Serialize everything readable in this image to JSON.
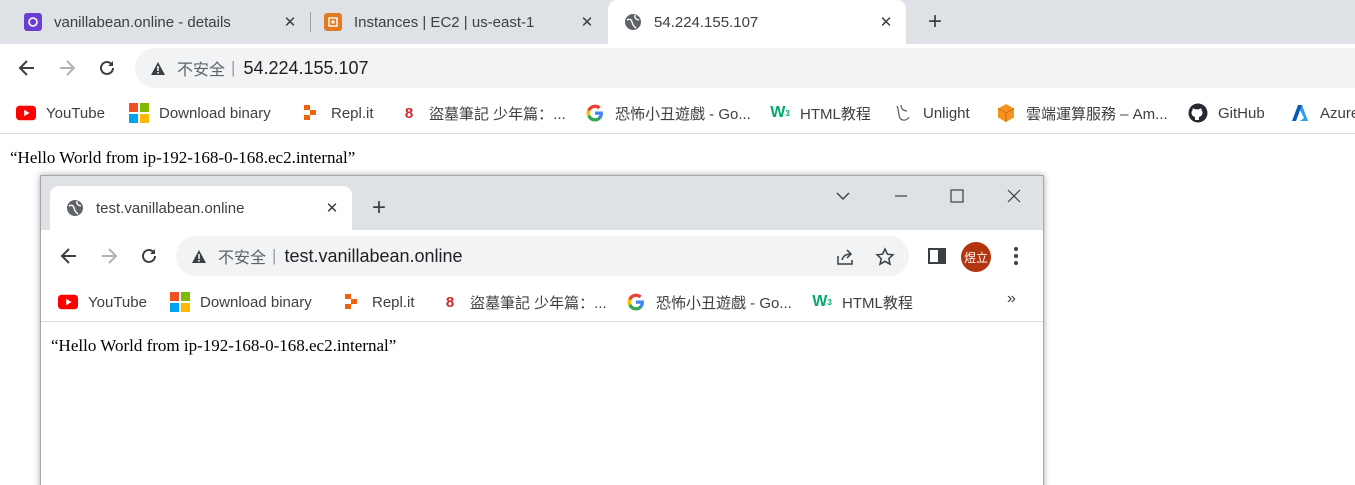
{
  "back_browser": {
    "tabs": [
      {
        "title": "vanillabean.online - details",
        "icon": "app-icon",
        "active": false
      },
      {
        "title": "Instances | EC2 | us-east-1",
        "icon": "aws-ec2-icon",
        "active": false
      },
      {
        "title": "54.224.155.107",
        "icon": "globe-icon",
        "active": true
      }
    ],
    "omnibox": {
      "security_label": "不安全",
      "url": "54.224.155.107"
    },
    "bookmarks": [
      {
        "label": "YouTube",
        "icon": "youtube-icon"
      },
      {
        "label": "Download binary",
        "icon": "windows-icon"
      },
      {
        "label": "Repl.it",
        "icon": "replit-icon"
      },
      {
        "label": "盜墓筆記 少年篇：...",
        "icon": "figure-8-icon"
      },
      {
        "label": "恐怖小丑遊戲 - Go...",
        "icon": "google-icon"
      },
      {
        "label": "HTML教程",
        "icon": "w3-icon"
      },
      {
        "label": "Unlight",
        "icon": "unlight-icon"
      },
      {
        "label": "雲端運算服務 – Am...",
        "icon": "aws-cube-icon"
      },
      {
        "label": "GitHub",
        "icon": "github-icon"
      },
      {
        "label": "Azure",
        "icon": "azure-icon"
      }
    ],
    "page_text": "“Hello World from ip-192-168-0-168.ec2.internal”"
  },
  "front_browser": {
    "tab": {
      "title": "test.vanillabean.online",
      "icon": "globe-icon"
    },
    "omnibox": {
      "security_label": "不安全",
      "url": "test.vanillabean.online"
    },
    "avatar_text": "煜立",
    "bookmarks": [
      {
        "label": "YouTube",
        "icon": "youtube-icon"
      },
      {
        "label": "Download binary",
        "icon": "windows-icon"
      },
      {
        "label": "Repl.it",
        "icon": "replit-icon"
      },
      {
        "label": "盜墓筆記 少年篇：...",
        "icon": "figure-8-icon"
      },
      {
        "label": "恐怖小丑遊戲 - Go...",
        "icon": "google-icon"
      },
      {
        "label": "HTML教程",
        "icon": "w3-icon"
      }
    ],
    "more_bookmarks": "»",
    "page_text": "“Hello World from ip-192-168-0-168.ec2.internal”"
  },
  "colors": {
    "accent": "#1a73e8",
    "avatar": "#b3350f",
    "youtube": "#ff0000",
    "w3": "#04aa6d"
  }
}
